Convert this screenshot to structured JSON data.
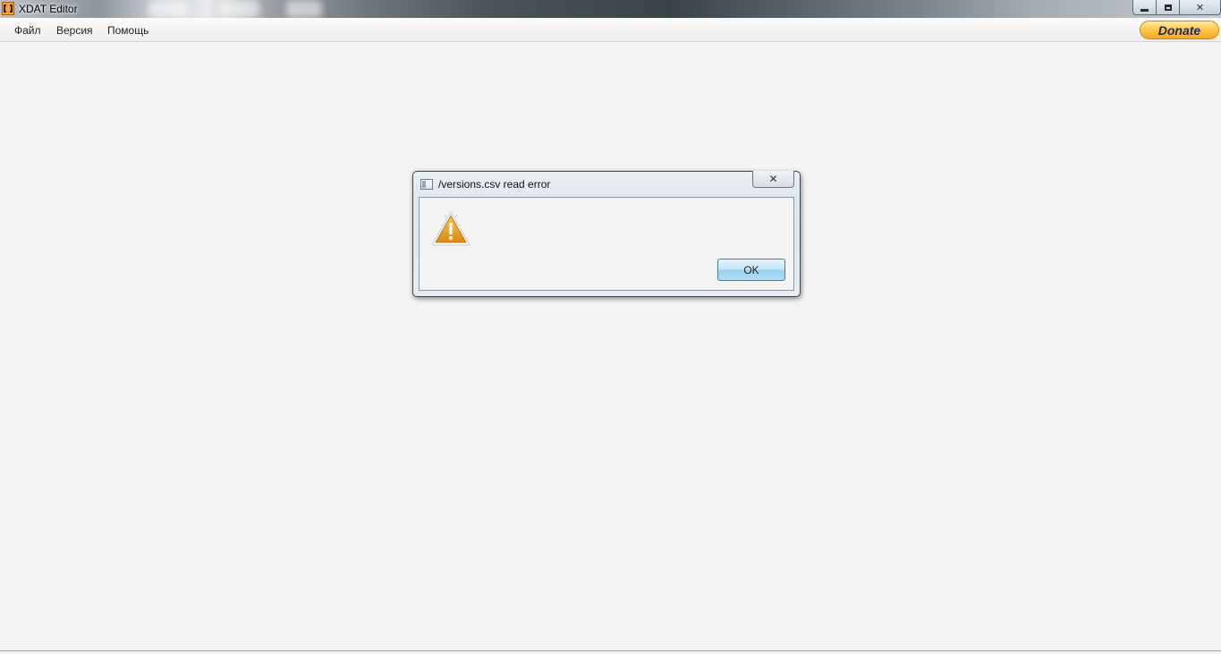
{
  "window": {
    "title": "XDAT Editor",
    "controls": {
      "minimize_icon": "minimize-icon",
      "maximize_icon": "restore-icon",
      "close_symbol": "✕"
    }
  },
  "menu": {
    "items": [
      {
        "label": "Файл"
      },
      {
        "label": "Версия"
      },
      {
        "label": "Помощь"
      }
    ],
    "donate_label": "Donate"
  },
  "dialog": {
    "title": "/versions.csv read error",
    "close_symbol": "✕",
    "icon": "warning-icon",
    "ok_label": "OK"
  },
  "colors": {
    "donate": "#ffc94a",
    "warning": "#e29a1e",
    "ok_button": "#b1dcf2"
  }
}
